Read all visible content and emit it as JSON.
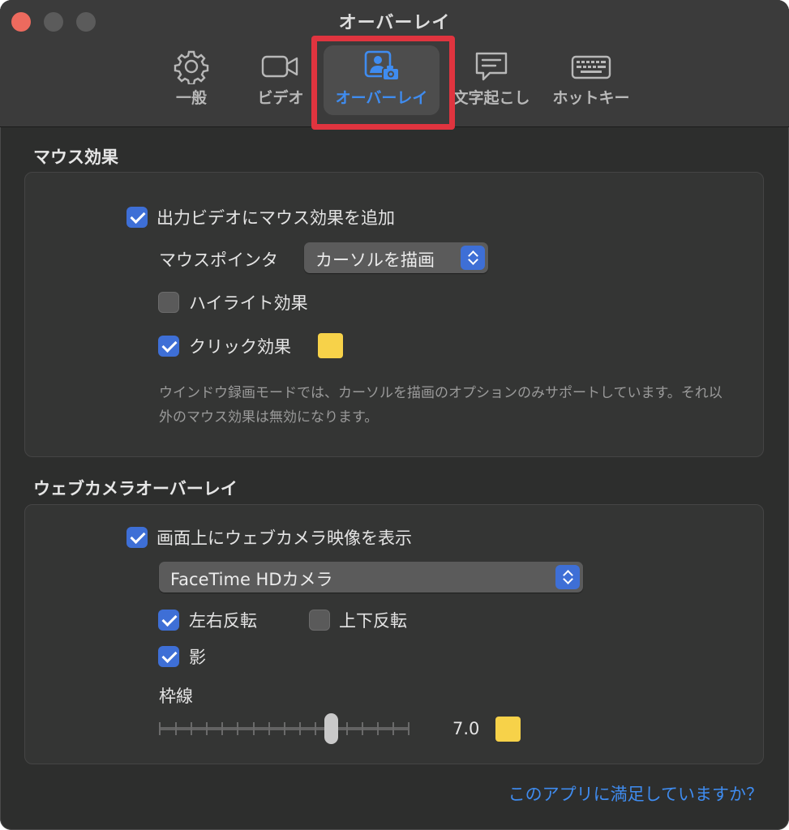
{
  "window": {
    "title": "オーバーレイ"
  },
  "toolbar": {
    "tabs": [
      {
        "label": "一般",
        "icon": "gear-icon"
      },
      {
        "label": "ビデオ",
        "icon": "video-camera-icon"
      },
      {
        "label": "オーバーレイ",
        "icon": "person-camera-icon",
        "active": true
      },
      {
        "label": "文字起こし",
        "icon": "speech-bubble-icon"
      },
      {
        "label": "ホットキー",
        "icon": "keyboard-icon"
      }
    ]
  },
  "mouse_effects": {
    "title": "マウス効果",
    "add_effects": {
      "label": "出力ビデオにマウス効果を追加",
      "checked": true
    },
    "pointer": {
      "label": "マウスポインタ",
      "value": "カーソルを描画"
    },
    "highlight": {
      "label": "ハイライト効果",
      "checked": false
    },
    "click": {
      "label": "クリック効果",
      "checked": true,
      "color": "#f7d249"
    },
    "note": "ウインドウ録画モードでは、カーソルを描画のオプションのみサポートしています。それ以外のマウス効果は無効になります。"
  },
  "webcam_overlay": {
    "title": "ウェブカメラオーバーレイ",
    "show_webcam": {
      "label": "画面上にウェブカメラ映像を表示",
      "checked": true
    },
    "camera": {
      "value": "FaceTime HDカメラ"
    },
    "flip_horizontal": {
      "label": "左右反転",
      "checked": true
    },
    "flip_vertical": {
      "label": "上下反転",
      "checked": false
    },
    "shadow": {
      "label": "影",
      "checked": true
    },
    "border": {
      "label": "枠線",
      "value": "7.0",
      "level": 0.7,
      "color": "#f7d249"
    }
  },
  "footer": {
    "link": "このアプリに満足していますか？"
  },
  "colors": {
    "accent": "#3e6fd6",
    "link": "#3f8cf0",
    "highlight_frame": "#e0343f"
  }
}
